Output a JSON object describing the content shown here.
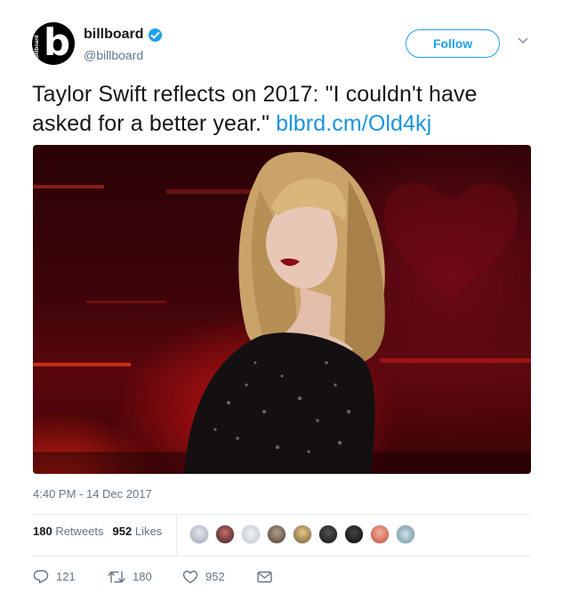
{
  "header": {
    "display_name": "billboard",
    "handle": "@billboard",
    "follow_label": "Follow",
    "avatar_letter": "b",
    "avatar_side_text": "billboard"
  },
  "tweet": {
    "text": "Taylor Swift reflects on 2017: \"I couldn't have asked for a better year.\"",
    "link": "blbrd.cm/Old4kj",
    "timestamp": "4:40 PM - 14 Dec 2017"
  },
  "stats": {
    "retweets_count": "180",
    "retweets_label": "Retweets",
    "likes_count": "952",
    "likes_label": "Likes"
  },
  "actions": {
    "replies": "121",
    "retweets": "180",
    "likes": "952"
  },
  "colors": {
    "accent": "#1da1f2",
    "link": "#1b95e0",
    "muted": "#657786",
    "like": "#e0245e"
  },
  "icons": {
    "verified": "verified-badge-icon",
    "caret": "chevron-down-icon",
    "reply": "reply-icon",
    "retweet": "retweet-icon",
    "like": "heart-icon",
    "dm": "envelope-icon"
  }
}
